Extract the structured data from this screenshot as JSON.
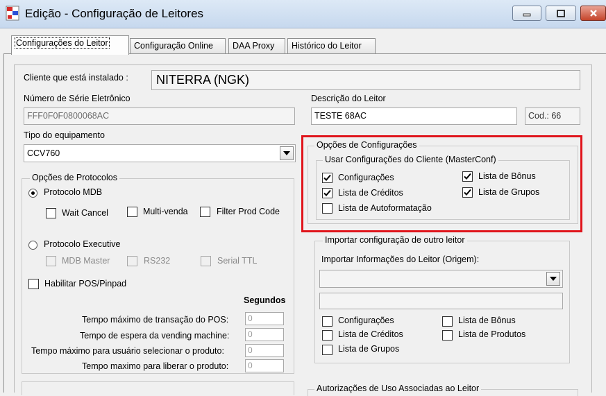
{
  "window": {
    "title": "Edição - Configuração de Leitores",
    "colors": {
      "close_button": "#c5452b",
      "highlight_box": "#e0141b",
      "titlebar": "#c6d8ee"
    }
  },
  "tabs": [
    {
      "label": "Configurações do Leitor",
      "active": true
    },
    {
      "label": "Configuração Online",
      "active": false
    },
    {
      "label": "DAA Proxy",
      "active": false
    },
    {
      "label": "Histórico do Leitor",
      "active": false
    }
  ],
  "client": {
    "label": "Cliente que está instalado :",
    "value": "NITERRA (NGK)"
  },
  "serial": {
    "label": "Número de Série Eletrônico",
    "value": "FFF0F0F0800068AC"
  },
  "description": {
    "label": "Descrição do Leitor",
    "value": "TESTE 68AC",
    "code": "Cod.: 66"
  },
  "equipment": {
    "label": "Tipo do equipamento",
    "value": "CCV760"
  },
  "protocols": {
    "legend": "Opções de Protocolos",
    "mdb": {
      "label": "Protocolo MDB",
      "selected": true
    },
    "mdb_options": [
      {
        "label": "Wait Cancel",
        "checked": false
      },
      {
        "label": "Multi-venda",
        "checked": false
      },
      {
        "label": "Filter Prod Code",
        "checked": false
      }
    ],
    "executive": {
      "label": "Protocolo Executive",
      "selected": false
    },
    "executive_options": [
      {
        "label": "MDB Master",
        "checked": false
      },
      {
        "label": "RS232",
        "checked": false
      },
      {
        "label": "Serial TTL",
        "checked": false
      }
    ],
    "pos": {
      "label": "Habilitar POS/Pinpad",
      "checked": false
    },
    "seconds_header": "Segundos",
    "timeouts": [
      {
        "label": "Tempo máximo de transação do POS:",
        "value": "0"
      },
      {
        "label": "Tempo de espera da vending machine:",
        "value": "0"
      },
      {
        "label": "Tempo máximo para usuário selecionar o produto:",
        "value": "0"
      },
      {
        "label": "Tempo maximo para liberar o produto:",
        "value": "0"
      }
    ]
  },
  "config_options": {
    "legend": "Opções de Configurações",
    "masterconf_legend": "Usar Configurações do Cliente (MasterConf)",
    "items": [
      {
        "label": "Configurações",
        "checked": true
      },
      {
        "label": "Lista de Créditos",
        "checked": true
      },
      {
        "label": "Lista de Autoformatação",
        "checked": false
      },
      {
        "label": "Lista de Bônus",
        "checked": true
      },
      {
        "label": "Lista de Grupos",
        "checked": true
      }
    ]
  },
  "import": {
    "legend": "Importar configuração de outro leitor",
    "source_label": "Importar Informações do Leitor (Origem):",
    "source_value": "",
    "items": [
      {
        "label": "Configurações",
        "checked": false
      },
      {
        "label": "Lista de Créditos",
        "checked": false
      },
      {
        "label": "Lista de Grupos",
        "checked": false
      },
      {
        "label": "Lista de Bônus",
        "checked": false
      },
      {
        "label": "Lista de Produtos",
        "checked": false
      }
    ]
  },
  "authorizations": {
    "legend": "Autorizações de Uso Associadas ao Leitor"
  }
}
